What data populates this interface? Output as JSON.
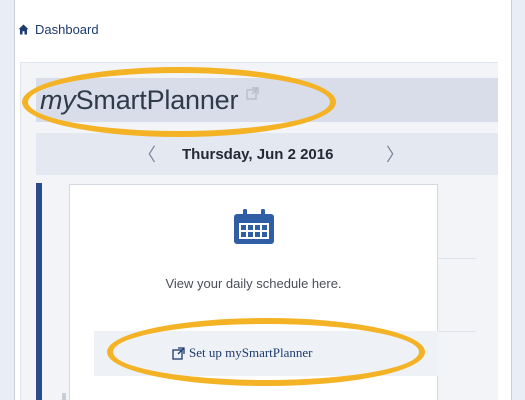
{
  "breadcrumb": {
    "label": "Dashboard",
    "icon": "home-icon"
  },
  "app": {
    "title_prefix": "my",
    "title_main": "SmartPlanner",
    "title_icon": "external-link-icon"
  },
  "date_nav": {
    "prev_label": "〈",
    "date": "Thursday, Jun 2 2016",
    "next_label": "〉"
  },
  "card": {
    "icon": "calendar-icon",
    "message": "View your daily schedule here.",
    "setup_label": "Set up mySmartPlanner",
    "setup_icon": "external-link-icon"
  },
  "colors": {
    "accent_navy": "#2a4d8a",
    "highlight_ellipse": "#f4b225",
    "calendar_blue": "#2f5ea4"
  }
}
